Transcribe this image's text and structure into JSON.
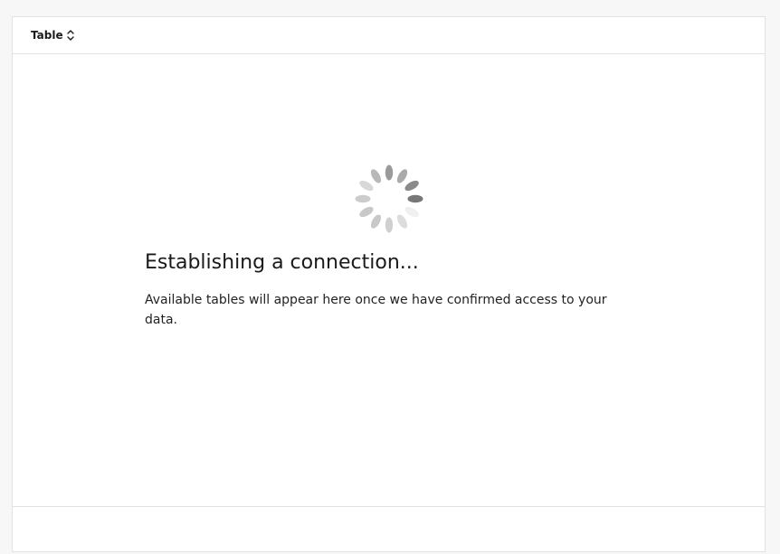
{
  "header": {
    "sort_label": "Table",
    "sort_icon": "chevron-up-down-icon"
  },
  "loading": {
    "spinner_icon": "loading-spinner-icon",
    "title": "Establishing a connection...",
    "description": "Available tables will appear here once we have confirmed access to your data."
  },
  "colors": {
    "background": "#f7f7f7",
    "panel": "#ffffff",
    "border": "#e2e2e2",
    "text": "#1a1a1a"
  }
}
